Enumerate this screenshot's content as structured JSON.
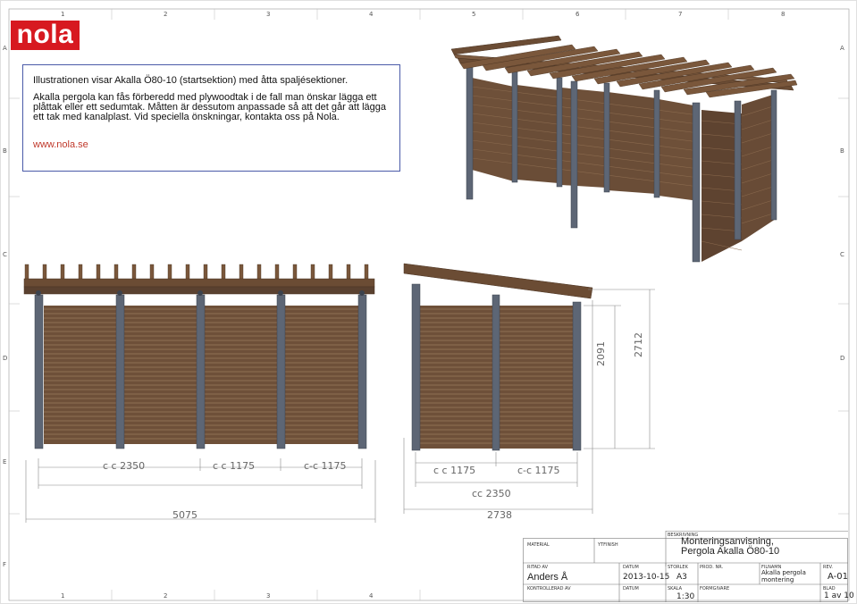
{
  "logo": {
    "text": "nola"
  },
  "info": {
    "title": "Illustrationen visar Akalla Ö80-10 (startsektion) med åtta spaljésektioner.",
    "body": "Akalla pergola kan fås förberedd med plywoodtak i de fall man önskar lägga ett plåttak eller ett sedumtak. Måtten är dessutom anpassade så att det går att lägga ett tak med kanalplast. Vid speciella önskningar, kontakta oss på Nola.",
    "link": "www.nola.se"
  },
  "grid": {
    "columns": [
      "1",
      "2",
      "3",
      "4",
      "5",
      "6",
      "7",
      "8"
    ],
    "rows": [
      "A",
      "B",
      "C",
      "D",
      "E",
      "F"
    ]
  },
  "front_view": {
    "cc_outer": "c c 2350",
    "cc_mid": "c c 1175",
    "cc_right": "c-c 1175",
    "total_width": "5075"
  },
  "side_view": {
    "cc_left": "c c 1175",
    "cc_right": "c-c 1175",
    "cc_total": "cc 2350",
    "total_width": "2738",
    "height_low": "2091",
    "height_high": "2712"
  },
  "title_block": {
    "beskrivning_label": "BESKRIVNING",
    "title_line1": "Monteringsanvisning,",
    "title_line2": "Pergola Akalla Ö80-10",
    "material_label": "MATERIAL",
    "ytfinish_label": "YTFINISH",
    "ritad_av_label": "RITAD AV",
    "ritad_av": "Anders Å",
    "datum_label": "DATUM",
    "datum": "2013-10-15",
    "storlek_label": "STORLEK",
    "storlek": "A3",
    "prod_nr_label": "PROD. NR.",
    "filnamn_label": "FILNAMN",
    "filnamn": "Akalla pergola montering",
    "rev_label": "REV.",
    "rev": "A-01",
    "kontrollerad_label": "KONTROLLERAD AV",
    "datum2_label": "DATUM",
    "skala_label": "SKALA",
    "skala": "1:30",
    "formgivare_label": "FORMGIVARE",
    "blad_label": "BLAD",
    "blad": "1 av 10"
  },
  "colors": {
    "wood_dark": "#5a4130",
    "wood_mid": "#7a5a40",
    "post": "#5d6675",
    "brand": "#d71920",
    "info_border": "#4a5aa8"
  }
}
